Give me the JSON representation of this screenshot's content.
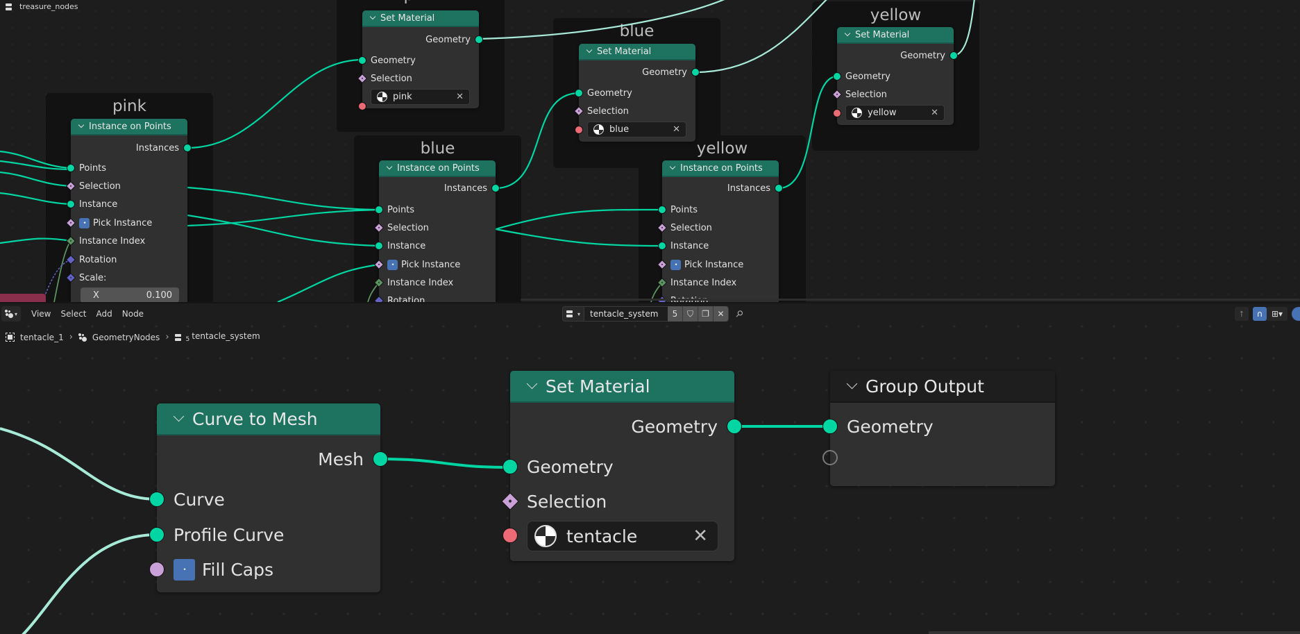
{
  "top_editor": {
    "tree_name": "treasure_nodes",
    "frames": {
      "pink_iop": "pink",
      "pink_setmat": "pink",
      "blue_iop": "blue",
      "blue_setmat": "blue",
      "yellow_iop": "yellow",
      "yellow_setmat": "yellow"
    },
    "instance_on_points": {
      "title": "Instance on Points",
      "output": "Instances",
      "inputs": [
        "Points",
        "Selection",
        "Instance",
        "Pick Instance",
        "Instance Index",
        "Rotation",
        "Scale:"
      ],
      "pick_instance_checked": true,
      "scale_x_label": "X",
      "scale_x_value": "0.100"
    },
    "set_material": {
      "title": "Set Material",
      "output": "Geometry",
      "inputs": [
        "Geometry",
        "Selection"
      ]
    },
    "materials": {
      "pink": "pink",
      "blue": "blue",
      "yellow": "yellow"
    }
  },
  "header": {
    "menus": [
      "View",
      "Select",
      "Add",
      "Node"
    ],
    "node_group_name": "tentacle_system",
    "user_count": "5",
    "fake_user_icon": "shield-icon",
    "duplicate_icon": "duplicate-icon",
    "unlink_icon": "close-icon",
    "pin_icon": "pin-icon"
  },
  "breadcrumb": [
    "tentacle_1",
    "GeometryNodes",
    "tentacle_system"
  ],
  "breadcrumb_subscript": "5",
  "bottom_editor": {
    "curve_to_mesh": {
      "title": "Curve to Mesh",
      "output": "Mesh",
      "inputs": [
        "Curve",
        "Profile Curve",
        "Fill Caps"
      ],
      "fill_caps_checked": true
    },
    "set_material": {
      "title": "Set Material",
      "output": "Geometry",
      "inputs": [
        "Geometry",
        "Selection"
      ],
      "material": "tentacle"
    },
    "group_output": {
      "title": "Group Output",
      "inputs": [
        "Geometry"
      ]
    }
  },
  "colors": {
    "node_header_geometry": "#1e7260",
    "geometry_socket": "#00d6a3",
    "bool_socket": "#c9a1d8",
    "int_socket": "#5b9460",
    "vector_socket": "#6363c7",
    "material_socket": "#eb6a76",
    "checkbox": "#4772b3"
  }
}
